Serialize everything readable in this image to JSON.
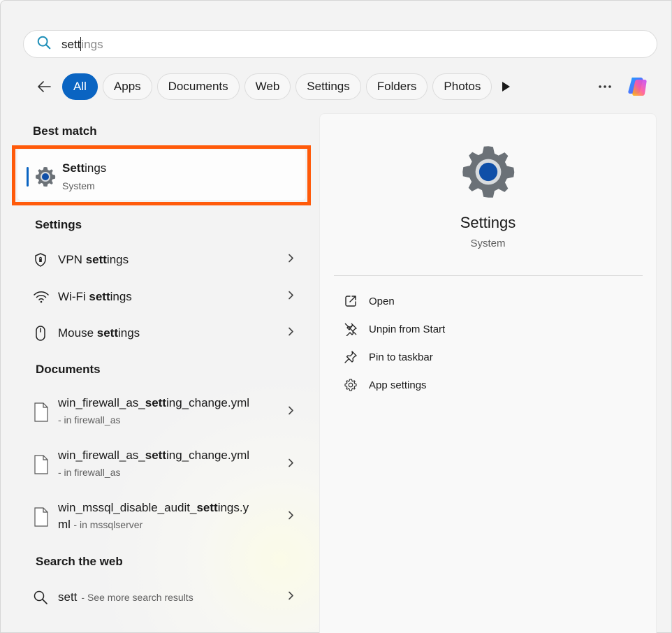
{
  "search": {
    "typed": "sett",
    "suggestion": "ings"
  },
  "filters": [
    "All",
    "Apps",
    "Documents",
    "Web",
    "Settings",
    "Folders",
    "Photos"
  ],
  "best_match": {
    "heading": "Best match",
    "title_bold": "Sett",
    "title_rest": "ings",
    "subtitle": "System"
  },
  "settings_section": {
    "heading": "Settings",
    "items": [
      {
        "pre": "VPN ",
        "bold": "sett",
        "post": "ings"
      },
      {
        "pre": "Wi-Fi ",
        "bold": "sett",
        "post": "ings"
      },
      {
        "pre": "Mouse ",
        "bold": "sett",
        "post": "ings"
      }
    ]
  },
  "documents_section": {
    "heading": "Documents",
    "items": [
      {
        "pre": "win_firewall_as_",
        "bold": "sett",
        "post": "ing_change.yml",
        "line2": "",
        "location": "- in firewall_as"
      },
      {
        "pre": "win_firewall_as_",
        "bold": "sett",
        "post": "ing_change.yml",
        "line2": "",
        "location": "- in firewall_as"
      },
      {
        "pre": "win_mssql_disable_audit_",
        "bold": "sett",
        "post": "ings.y",
        "line2": "ml",
        "location": "- in mssqlserver"
      }
    ]
  },
  "web_section": {
    "heading": "Search the web",
    "query": "sett",
    "hint": "- See more search results"
  },
  "preview": {
    "title": "Settings",
    "subtitle": "System",
    "actions": [
      "Open",
      "Unpin from Start",
      "Pin to taskbar",
      "App settings"
    ]
  },
  "colors": {
    "accent": "#0a64c2",
    "highlight": "#ff5a0a"
  }
}
